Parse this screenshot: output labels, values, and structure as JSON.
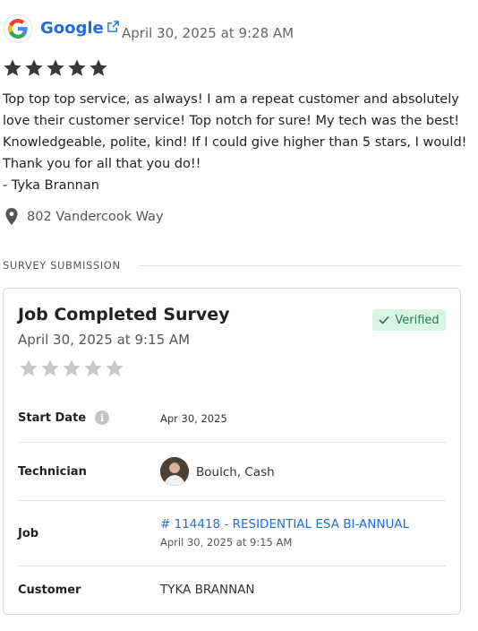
{
  "review": {
    "source": "Google",
    "date": "April 30, 2025 at 9:28 AM",
    "rating": 5,
    "body": "Top top top service, as always! I am a repeat customer and absolutely love their customer service! Top notch for sure! My tech was the best! Knowledgeable, polite, kind! If I could give higher than 5 stars, I would! Thank you for all that you do!!",
    "signature": "- Tyka Brannan",
    "location": "802 Vandercook Way"
  },
  "survey": {
    "section_title": "SURVEY SUBMISSION",
    "title": "Job Completed Survey",
    "date": "April 30, 2025 at 9:15 AM",
    "badge": "Verified",
    "rating": 0,
    "rows": {
      "start_date": {
        "label": "Start Date",
        "value": "Apr 30, 2025"
      },
      "technician": {
        "label": "Technician",
        "value": "Boulch, Cash"
      },
      "job": {
        "label": "Job",
        "value": "# 114418 - RESIDENTIAL ESA BI-ANNUAL",
        "sub": "April 30, 2025 at 9:15 AM"
      },
      "customer": {
        "label": "Customer",
        "value": "TYKA BRANNAN"
      }
    }
  },
  "colors": {
    "link": "#1d6fe0",
    "star_filled": "#3a3a3a",
    "star_empty": "#c8c8c8",
    "verified_bg": "#d9f5e3",
    "verified_text": "#2a7a4b"
  },
  "icons": {
    "source_logo": "google-logo",
    "external": "external-link-icon",
    "location": "map-pin-icon",
    "verified": "check-icon",
    "info": "info-icon"
  }
}
